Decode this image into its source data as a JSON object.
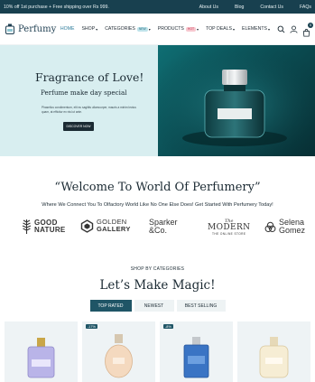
{
  "topbar": {
    "promo": "10% off 1st purchase + Free shipping over Rs 999.",
    "links": [
      "About Us",
      "Blog",
      "Contact Us",
      "FAQs"
    ]
  },
  "header": {
    "logo_text": "Perfumy",
    "nav": [
      {
        "label": "HOME",
        "dropdown": false,
        "badge": ""
      },
      {
        "label": "SHOP",
        "dropdown": true,
        "badge": ""
      },
      {
        "label": "CATEGORIES",
        "dropdown": true,
        "badge": "NEW"
      },
      {
        "label": "PRODUCTS",
        "dropdown": true,
        "badge": "HOT"
      },
      {
        "label": "TOP DEALS",
        "dropdown": true,
        "badge": ""
      },
      {
        "label": "ELEMENTS",
        "dropdown": true,
        "badge": ""
      }
    ],
    "cart_count": "0",
    "icons": [
      "search-icon",
      "user-icon",
      "cart-icon"
    ]
  },
  "hero": {
    "title": "Fragrance of Love!",
    "subtitle": "Perfume make day special",
    "description": "Phasellus condimentum, elit eu sagittis ullamcorper, mauris a minim lectus quam, at efficitur ex nisl ut ante.",
    "button": "DISCOVER NOW"
  },
  "welcome": {
    "title": "“Welcome To World Of Perfumery”",
    "subtitle": "Where We Connect You To Olfactory World Like No One Else Does! Get Started With Perfumery Today!"
  },
  "brands": [
    {
      "line1": "GOOD",
      "line2": "NATURE"
    },
    {
      "line1": "GOLDEN",
      "line2": "GALLERY"
    },
    {
      "line1": "Sparker",
      "line2": "&Co."
    },
    {
      "line1": "The",
      "line2": "MODERN",
      "line3": "THE ONLINE STORE"
    },
    {
      "line1": "Selena",
      "line2": "Gomez"
    }
  ],
  "categories": {
    "label": "SHOP BY CATEGORIES",
    "title": "Let’s Make Magic!",
    "tabs": [
      "TOP RATED",
      "NEWEST",
      "BEST SELLING"
    ]
  },
  "products": [
    {
      "discount": ""
    },
    {
      "discount": "-17%"
    },
    {
      "discount": "-8%"
    },
    {
      "discount": ""
    }
  ],
  "colors": {
    "topbar_bg": "#18404f",
    "accent": "#1f5566",
    "hero_left_bg": "#d8eef0"
  }
}
